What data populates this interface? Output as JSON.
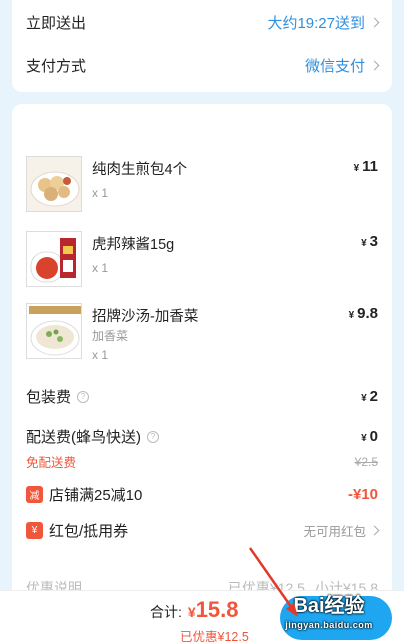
{
  "delivery": {
    "label": "立即送出",
    "value": "大约19:27送到"
  },
  "payment": {
    "label": "支付方式",
    "value": "微信支付"
  },
  "items": [
    {
      "name": "纯肉生煎包4个",
      "currency": "¥",
      "price": "11",
      "qty": "x 1",
      "option": ""
    },
    {
      "name": "虎邦辣酱15g",
      "currency": "¥",
      "price": "3",
      "qty": "x 1",
      "option": ""
    },
    {
      "name": "招牌沙汤-加香菜",
      "currency": "¥",
      "price": "9.8",
      "qty": "x 1",
      "option": "加香菜"
    }
  ],
  "packing_fee": {
    "label": "包装费",
    "currency": "¥",
    "amount": "2"
  },
  "delivery_fee": {
    "label": "配送费(蜂鸟快送)",
    "currency": "¥",
    "amount": "0",
    "free_label": "免配送费",
    "original": "¥2.5"
  },
  "discount": {
    "tag": "减",
    "label": "店铺满25减10",
    "amount": "-¥10"
  },
  "coupon": {
    "tag": "¥",
    "label": "红包/抵用券",
    "value": "无可用红包"
  },
  "summary_peek": {
    "left": "优惠说明",
    "mid": "已优惠¥12.5",
    "right": "小计¥15.8"
  },
  "footer": {
    "total_label": "合计:",
    "currency": "¥",
    "total": "15.8",
    "saved": "已优惠¥12.5"
  },
  "watermark": {
    "brand": "Bai经验",
    "url": "jingyan.baidu.com"
  },
  "colors": {
    "accent": "#2f8fe0",
    "price_red": "#f0563b",
    "button": "#1ea6f0",
    "arrow": "#e23a2a"
  }
}
